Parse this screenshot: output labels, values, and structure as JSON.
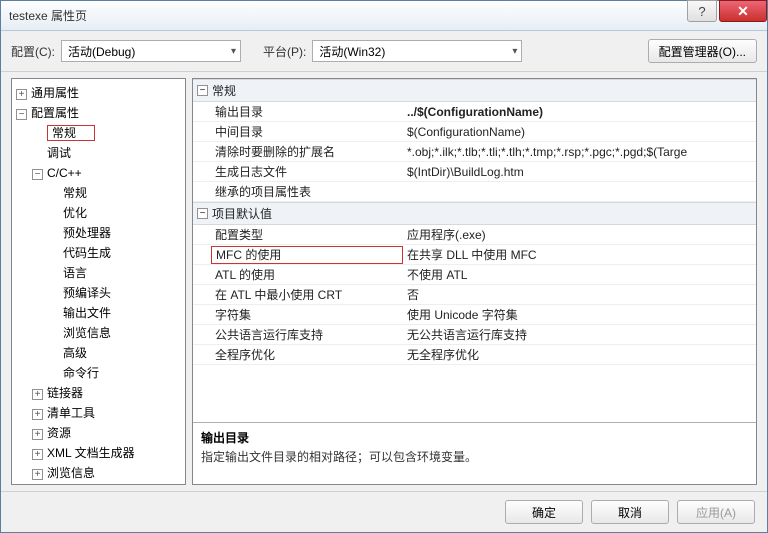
{
  "window": {
    "title": "testexe 属性页",
    "help": "?",
    "close": "✕"
  },
  "toolbar": {
    "config_label": "配置(C):",
    "config_value": "活动(Debug)",
    "platform_label": "平台(P):",
    "platform_value": "活动(Win32)",
    "manager": "配置管理器(O)..."
  },
  "tree": {
    "common": "通用属性",
    "config": "配置属性",
    "general": "常规",
    "debug": "调试",
    "cpp": "C/C++",
    "cpp_items": [
      "常规",
      "优化",
      "预处理器",
      "代码生成",
      "语言",
      "预编译头",
      "输出文件",
      "浏览信息",
      "高级",
      "命令行"
    ],
    "linker": "链接器",
    "manifest": "清单工具",
    "resources": "资源",
    "xmldoc": "XML 文档生成器",
    "browse": "浏览信息"
  },
  "grid": {
    "group1": "常规",
    "g1": [
      {
        "k": "输出目录",
        "v": "../$(ConfigurationName)",
        "bold": true
      },
      {
        "k": "中间目录",
        "v": "$(ConfigurationName)"
      },
      {
        "k": "清除时要删除的扩展名",
        "v": "*.obj;*.ilk;*.tlb;*.tli;*.tlh;*.tmp;*.rsp;*.pgc;*.pgd;$(Targe"
      },
      {
        "k": "生成日志文件",
        "v": "$(IntDir)\\BuildLog.htm"
      },
      {
        "k": "继承的项目属性表",
        "v": ""
      }
    ],
    "group2": "项目默认值",
    "g2": [
      {
        "k": "配置类型",
        "v": "应用程序(.exe)"
      },
      {
        "k": "MFC 的使用",
        "v": "在共享 DLL 中使用 MFC",
        "hl": true
      },
      {
        "k": "ATL 的使用",
        "v": "不使用 ATL"
      },
      {
        "k": "在 ATL 中最小使用 CRT",
        "v": "否"
      },
      {
        "k": "字符集",
        "v": "使用 Unicode 字符集"
      },
      {
        "k": "公共语言运行库支持",
        "v": "无公共语言运行库支持"
      },
      {
        "k": "全程序优化",
        "v": "无全程序优化"
      }
    ]
  },
  "desc": {
    "title": "输出目录",
    "body": "指定输出文件目录的相对路径；可以包含环境变量。"
  },
  "buttons": {
    "ok": "确定",
    "cancel": "取消",
    "apply": "应用(A)"
  }
}
